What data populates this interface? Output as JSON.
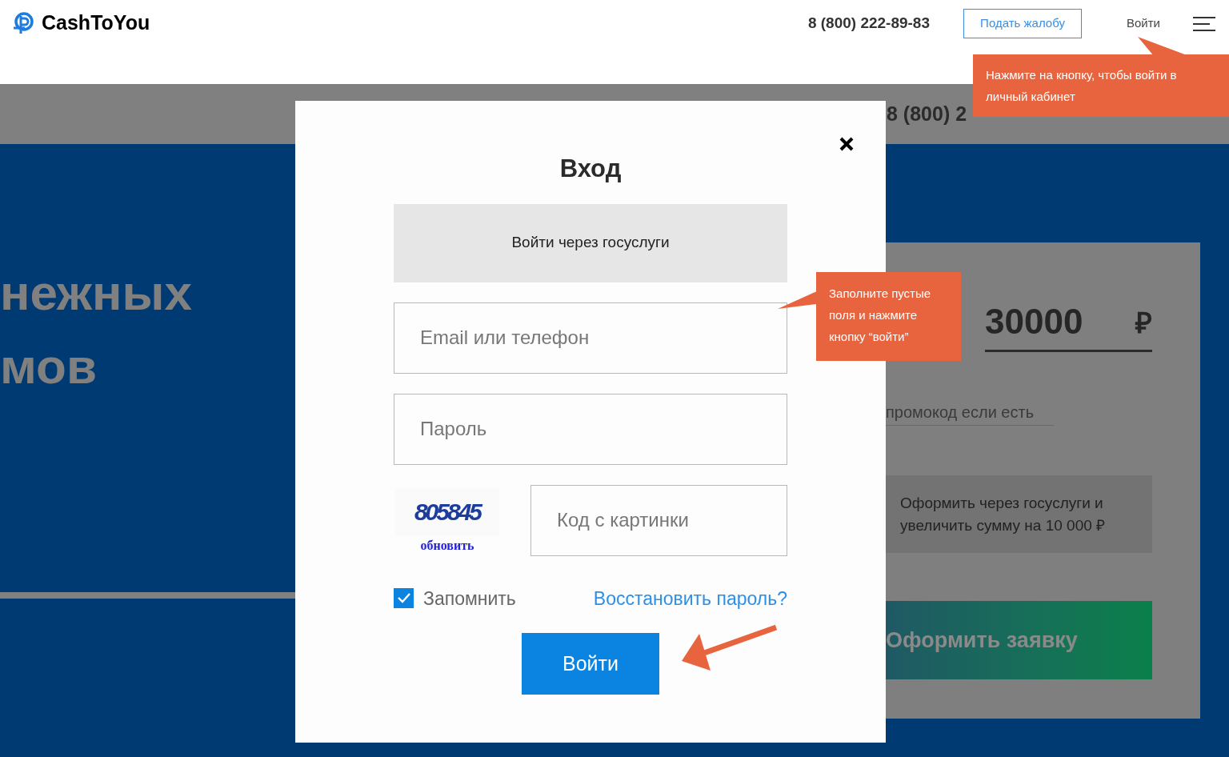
{
  "header": {
    "logo": "CashToYou",
    "phone": "8 (800) 222-89-83",
    "complaint_button": "Подать жалобу",
    "login_link": "Войти"
  },
  "background": {
    "phone_fragment": "8 (800) 2",
    "hero_lines": [
      "нежных",
      "мов"
    ],
    "amount": "30000",
    "currency": "₽",
    "promo": {
      "placeholder": "промокод если есть"
    },
    "gosuslugi_offer": "Оформить через госуслуги и увеличить сумму на 10 000 ₽",
    "apply_button": "Оформить заявку"
  },
  "modal": {
    "title": "Вход",
    "gosuslugi_button": "Войти через госуслуги",
    "email": {
      "placeholder": "Email или телефон"
    },
    "password": {
      "placeholder": "Пароль"
    },
    "captcha": {
      "code": "805845",
      "refresh_link": "обновить"
    },
    "code": {
      "placeholder": "Код с картинки"
    },
    "remember": {
      "label": "Запомнить",
      "checked": true
    },
    "restore_link": "Восстановить пароль?",
    "submit_button": "Войти"
  },
  "callouts": [
    {
      "text": "Нажмите на кнопку, чтобы войти в личный кабинет"
    },
    {
      "text": "Заполните пустые поля и нажмите кнопку “войти”"
    }
  ]
}
